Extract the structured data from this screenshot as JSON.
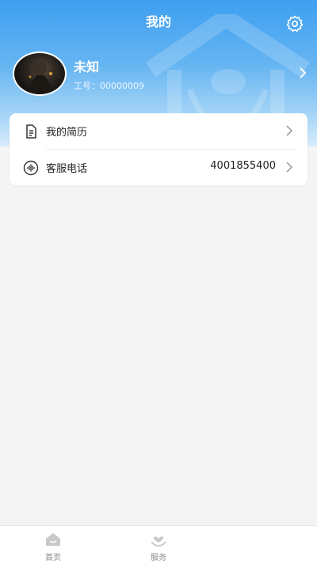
{
  "header": {
    "title": "我的",
    "settings_icon": "gear-icon"
  },
  "profile": {
    "name": "未知",
    "id_label": "工号：",
    "id_value": "00000009"
  },
  "menu": {
    "items": [
      {
        "label": "我的简历",
        "value": "",
        "icon": "document-icon"
      },
      {
        "label": "客服电话",
        "value": "4001855400",
        "icon": "voice-wave-icon"
      }
    ]
  },
  "tabbar": {
    "items": [
      {
        "label": "首页",
        "icon": "home-icon"
      },
      {
        "label": "服务",
        "icon": "service-hands-icon"
      }
    ]
  },
  "colors": {
    "header_top": "#3d9ff0",
    "header_bottom": "#d8ecfb",
    "page_bg": "#f4f4f5",
    "card_bg": "#ffffff"
  }
}
